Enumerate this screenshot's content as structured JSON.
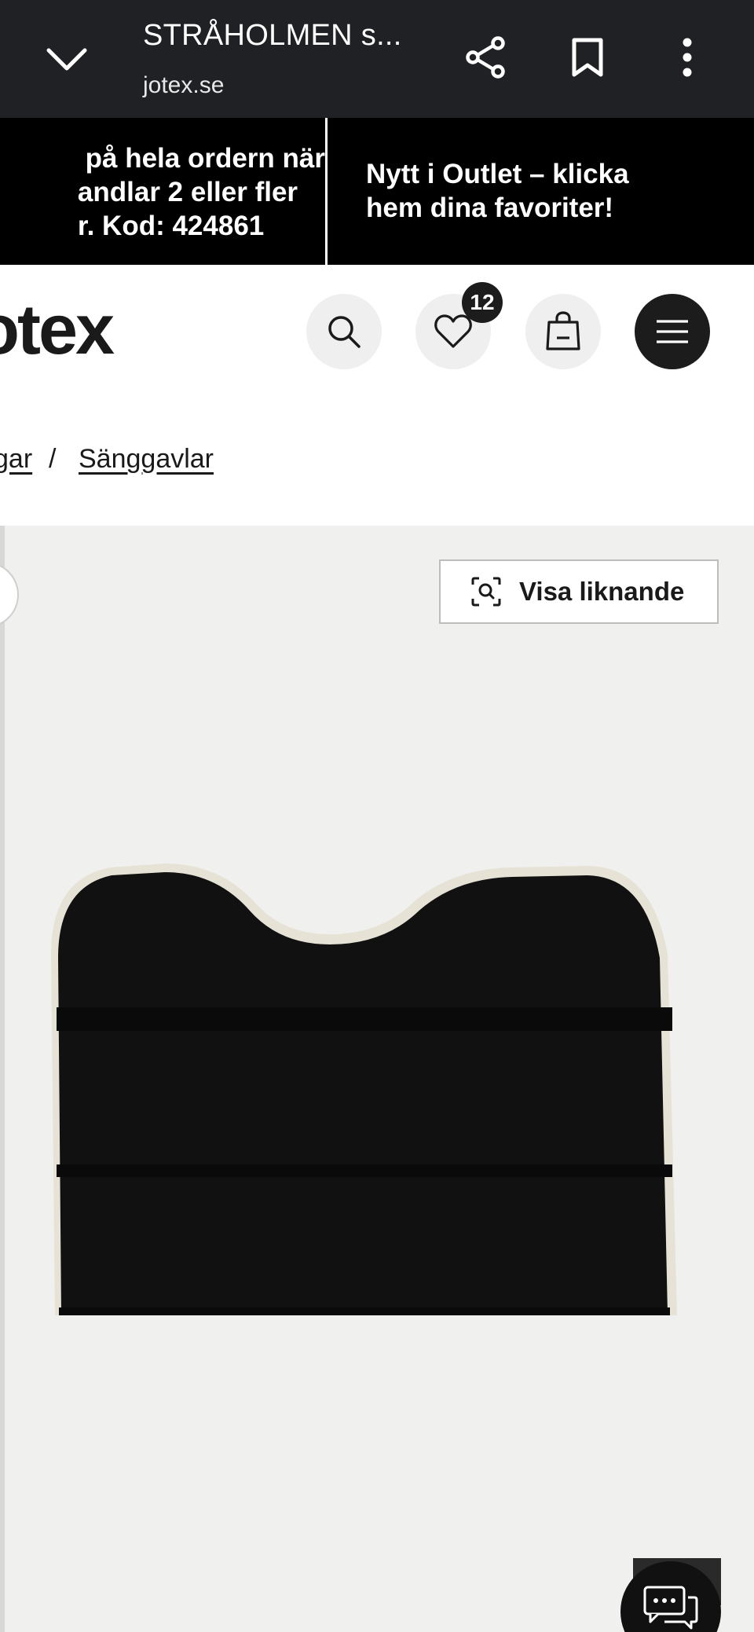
{
  "browser": {
    "title": "STRÅHOLMEN s...",
    "domain": "jotex.se",
    "collapse_icon": "chevron-down-icon",
    "share_icon": "share-icon",
    "bookmark_icon": "bookmark-icon",
    "more_icon": "more-vert-icon"
  },
  "promo": {
    "message1": " på hela ordern när\nandlar 2 eller fler\nr. Kod: 424861",
    "message2": "Nytt i Outlet – klicka\nhem dina favoriter!"
  },
  "header": {
    "logo": "otex",
    "wishlist_count": "12",
    "icons": [
      "search-icon",
      "heart-icon",
      "shopping-bag-icon",
      "hamburger-menu-icon"
    ]
  },
  "breadcrumb": {
    "items": [
      "gar",
      "Sänggavlar"
    ],
    "separator": "/"
  },
  "gallery": {
    "similar_button_label": "Visa liknande",
    "similar_icon": "visual-search-icon",
    "chat_icon": "chat-bubble-icon"
  },
  "colors": {
    "topbar": "#202124",
    "promo": "#000000",
    "gallery_bg": "#f0f0ef",
    "product_fabric": "#111111",
    "product_piping": "#e7e2d6"
  }
}
